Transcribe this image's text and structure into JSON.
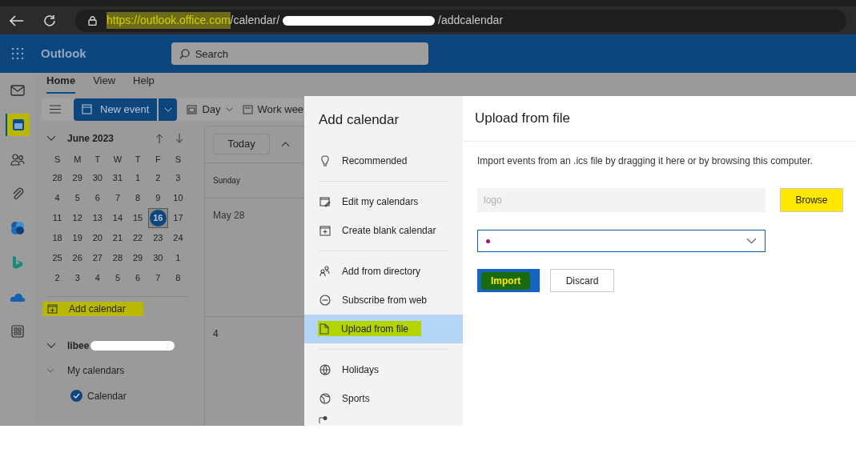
{
  "browser": {
    "url_host": "https://outlook.office.com",
    "url_path": "/calendar/",
    "url_tail": "/addcalendar"
  },
  "header": {
    "app_name": "Outlook",
    "search_placeholder": "Search"
  },
  "rail": [
    {
      "kind": "mail",
      "selected": false,
      "highlighted": false
    },
    {
      "kind": "calendar",
      "selected": true,
      "highlighted": true
    },
    {
      "kind": "people",
      "selected": false,
      "highlighted": false
    },
    {
      "kind": "attach",
      "selected": false,
      "highlighted": false
    },
    {
      "kind": "office",
      "selected": false,
      "highlighted": false
    },
    {
      "kind": "bing",
      "selected": false,
      "highlighted": false
    },
    {
      "kind": "cloud",
      "selected": false,
      "highlighted": false
    },
    {
      "kind": "apps",
      "selected": false,
      "highlighted": false
    }
  ],
  "ribbon_tabs": [
    {
      "label": "Home",
      "selected": true
    },
    {
      "label": "View",
      "selected": false
    },
    {
      "label": "Help",
      "selected": false
    }
  ],
  "toolbar": {
    "new_event": "New event",
    "views": [
      {
        "kind": "day",
        "label": "Day"
      },
      {
        "kind": "week",
        "label": "Work wee"
      }
    ]
  },
  "mini_calendar": {
    "title": "June 2023",
    "weekdays": [
      "S",
      "M",
      "T",
      "W",
      "T",
      "F",
      "S"
    ],
    "weeks": [
      [
        {
          "d": "28",
          "selected": false
        },
        {
          "d": "29",
          "selected": false
        },
        {
          "d": "30",
          "selected": false
        },
        {
          "d": "31",
          "selected": false
        },
        {
          "d": "1",
          "selected": false
        },
        {
          "d": "2",
          "selected": false
        },
        {
          "d": "3",
          "selected": false
        }
      ],
      [
        {
          "d": "4",
          "selected": false
        },
        {
          "d": "5",
          "selected": false
        },
        {
          "d": "6",
          "selected": false
        },
        {
          "d": "7",
          "selected": false
        },
        {
          "d": "8",
          "selected": false
        },
        {
          "d": "9",
          "selected": false
        },
        {
          "d": "10",
          "selected": false
        }
      ],
      [
        {
          "d": "11",
          "selected": false
        },
        {
          "d": "12",
          "selected": false
        },
        {
          "d": "13",
          "selected": false
        },
        {
          "d": "14",
          "selected": false
        },
        {
          "d": "15",
          "selected": false
        },
        {
          "d": "16",
          "selected": true
        },
        {
          "d": "17",
          "selected": false
        }
      ],
      [
        {
          "d": "18",
          "selected": false
        },
        {
          "d": "19",
          "selected": false
        },
        {
          "d": "20",
          "selected": false
        },
        {
          "d": "21",
          "selected": false
        },
        {
          "d": "22",
          "selected": false
        },
        {
          "d": "23",
          "selected": false
        },
        {
          "d": "24",
          "selected": false
        }
      ],
      [
        {
          "d": "25",
          "selected": false
        },
        {
          "d": "26",
          "selected": false
        },
        {
          "d": "27",
          "selected": false
        },
        {
          "d": "28",
          "selected": false
        },
        {
          "d": "29",
          "selected": false
        },
        {
          "d": "30",
          "selected": false
        },
        {
          "d": "1",
          "selected": false
        }
      ],
      [
        {
          "d": "2",
          "selected": false
        },
        {
          "d": "3",
          "selected": false
        },
        {
          "d": "4",
          "selected": false
        },
        {
          "d": "5",
          "selected": false
        },
        {
          "d": "6",
          "selected": false
        },
        {
          "d": "7",
          "selected": false
        },
        {
          "d": "8",
          "selected": false
        }
      ]
    ]
  },
  "add_calendar": {
    "label": "Add calendar",
    "highlighted": true
  },
  "account": {
    "name": "libee"
  },
  "groups": [
    {
      "label": "My calendars",
      "expanded": true,
      "children": [
        {
          "label": "Calendar",
          "checked": true
        }
      ]
    }
  ],
  "calendar_view": {
    "today": "Today",
    "day_header": "Sunday",
    "cells": [
      "May 28",
      "4"
    ]
  },
  "dialog": {
    "title": "Add calendar",
    "nav_sections": [
      [
        {
          "kind": "bulb",
          "label": "Recommended",
          "selected": false,
          "highlighted": false
        }
      ],
      [
        {
          "kind": "edit",
          "label": "Edit my calendars",
          "selected": false,
          "highlighted": false
        },
        {
          "kind": "blank",
          "label": "Create blank calendar",
          "selected": false,
          "highlighted": false
        }
      ],
      [
        {
          "kind": "directory",
          "label": "Add from directory",
          "selected": false,
          "highlighted": false
        },
        {
          "kind": "web",
          "label": "Subscribe from web",
          "selected": false,
          "highlighted": false
        },
        {
          "kind": "file",
          "label": "Upload from file",
          "selected": true,
          "highlighted": true
        }
      ],
      [
        {
          "kind": "globe",
          "label": "Holidays",
          "selected": false,
          "highlighted": false
        },
        {
          "kind": "sports",
          "label": "Sports",
          "selected": false,
          "highlighted": false
        }
      ]
    ],
    "panel_title": "Upload from file",
    "description": "Import events from an .ics file by dragging it here or by browsing this computer.",
    "file_value": "logo",
    "browse": {
      "label": "Browse",
      "highlighted": true
    },
    "import": {
      "label": "Import",
      "highlighted": true
    },
    "discard": "Discard"
  }
}
